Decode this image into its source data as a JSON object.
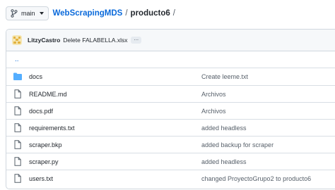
{
  "branch": {
    "label": "main"
  },
  "breadcrumb": {
    "repo": "WebScrapingMDS",
    "separator": "/",
    "directory": "producto6",
    "trailing": "/"
  },
  "latest_commit": {
    "author": "LitzyCastro",
    "message": "Delete FALABELLA.xlsx",
    "more": "..."
  },
  "parent_dir": "..",
  "files": [
    {
      "name": "docs",
      "type": "folder",
      "commit": "Create leeme.txt"
    },
    {
      "name": "README.md",
      "type": "file",
      "commit": "Archivos"
    },
    {
      "name": "docs.pdf",
      "type": "file",
      "commit": "Archivos"
    },
    {
      "name": "requirements.txt",
      "type": "file",
      "commit": "added headless"
    },
    {
      "name": "scraper.bkp",
      "type": "file",
      "commit": "added backup for scraper"
    },
    {
      "name": "scraper.py",
      "type": "file",
      "commit": "added headless"
    },
    {
      "name": "users.txt",
      "type": "file",
      "commit": "changed ProyectoGrupo2 to producto6"
    }
  ],
  "colors": {
    "link": "#0969da",
    "folder": "#54aeff",
    "border": "#d0d7de",
    "muted": "#57606a",
    "avatar": "#e3b341"
  },
  "icons": {
    "branch": "git-branch-icon",
    "caret": "caret-down-icon",
    "folder": "folder-icon",
    "file": "file-icon"
  }
}
